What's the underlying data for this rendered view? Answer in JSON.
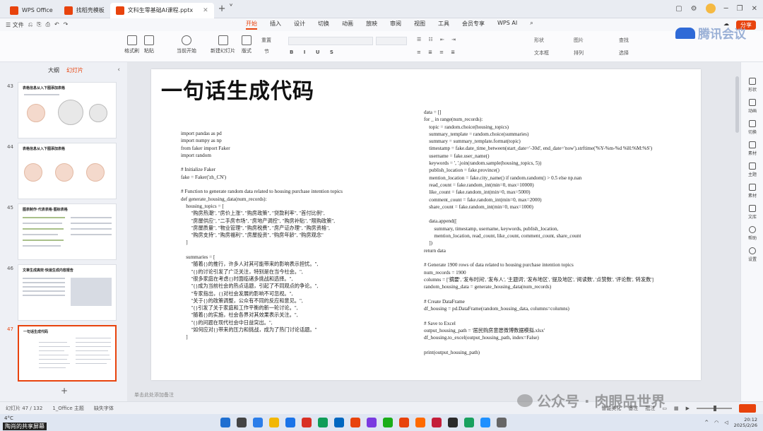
{
  "tabs": [
    {
      "label": "WPS Office",
      "color": "#e8430d"
    },
    {
      "label": "找稻壳模板",
      "color": "#e8430d"
    },
    {
      "label": "文科生零基础AI课程.pptx",
      "color": "#e8430d",
      "active": true
    }
  ],
  "menu": {
    "left_items": [
      "☰ 文件",
      "⎌",
      "⎘",
      "⎙",
      "↶",
      "↷"
    ],
    "tabs": [
      "开始",
      "插入",
      "设计",
      "切换",
      "动画",
      "放映",
      "审阅",
      "视图",
      "工具",
      "会员专享",
      "WPS AI"
    ],
    "active_tab": "开始",
    "share_label": "分享"
  },
  "ribbon": {
    "format_painter": "格式刷",
    "paste": "粘贴",
    "from_current": "当前开始",
    "new_slide": "新建幻灯片",
    "layout": "版式",
    "section": "节",
    "reset": "重置",
    "shape": "形状",
    "picture": "图片",
    "find": "查找",
    "arrange": "排列",
    "textbox": "文本框",
    "select": "选择"
  },
  "brand_watermark": "腾讯会议",
  "left_panel": {
    "tabs": [
      "大纲",
      "幻灯片"
    ],
    "active_tab": "幻灯片",
    "slides": [
      {
        "number": "43",
        "title": "表格信息从入下图添加表格"
      },
      {
        "number": "44",
        "title": "表格信息从入下图添加表格"
      },
      {
        "number": "45",
        "title": "图表制作·代表表格·图标表格"
      },
      {
        "number": "46",
        "title": "文章生成高效·快速生成内容报告"
      },
      {
        "number": "47",
        "title": "一句话生成代码",
        "selected": true
      }
    ],
    "add_label": "+"
  },
  "slide": {
    "title": "一句话生成代码",
    "code_left": "import pandas as pd\nimport numpy as np\nfrom faker import Faker\nimport random\n\n# Initialize Faker\nfake = Faker('zh_CN')\n\n# Function to generate random data related to housing purchase intention topics\ndef generate_housing_data(num_records):\n    housing_topics = [\n        \"购房热潮\", \"房价上涨\", \"购房政策\", \"贷款利率\", \"首付比例\",\n        \"房屋供应\", \"二手房市场\", \"房地产调控\", \"购房补贴\", \"限购政策\",\n        \"房屋质量\", \"物业管理\", \"购房税费\", \"房产证办理\", \"购房资格\",\n        \"购房支持\", \"购房福利\", \"房屋投资\", \"购房年龄\", \"购房观念\"\n    ]\n\n    summaries = [\n        \"随着{}的推行，许多人对其可能带来的影响表示担忧。\",\n        \"{}的讨论引发了广泛关注，特别是在当今社会。\",\n        \"很多家庭在考虑{}时面临诸多挑战和选择。\",\n        \"{}成为当前社会的热点话题，引起了不同观点的争论。\",\n        \"专家指出，{}对社会发展的影响不可忽视。\",\n        \"关于{}的政策调整，公众有不同的反应和意见。\",\n        \"{}引发了关于家庭和工作平衡的新一轮讨论。\",\n        \"随着{}的实施，社会各界对其效果表示关注。\",\n        \"{}的问题在现代社会中日益突出。\",\n        \"如何应对{}带来的压力和挑战，成为了热门讨论话题。\"\n    ]",
    "code_right": "data = []\nfor _ in range(num_records):\n    topic = random.choice(housing_topics)\n    summary_template = random.choice(summaries)\n    summary = summary_template.format(topic)\n    timestamp = fake.date_time_between(start_date='-30d', end_date='now').strftime('%Y-%m-%d %H:%M:%S')\n    username = fake.user_name()\n    keywords = ', '.join(random.sample(housing_topics, 5))\n    publish_location = fake.province()\n    mention_location = fake.city_name() if random.random() > 0.5 else np.nan\n    read_count = fake.random_int(min=0, max=10000)\n    like_count = fake.random_int(min=0, max=5000)\n    comment_count = fake.random_int(min=0, max=2000)\n    share_count = fake.random_int(min=0, max=1000)\n\n    data.append([\n        summary, timestamp, username, keywords, publish_location,\n        mention_location, read_count, like_count, comment_count, share_count\n    ])\nreturn data\n\n# Generate 1900 rows of data related to housing purchase intention topics\nnum_records = 1900\ncolumns = ['摘要', '发布时间', '发布人', '主题词', '发布地区', '提及地区', '阅读数', '点赞数', '评论数', '转发数']\nrandom_housing_data = generate_housing_data(num_records)\n\n# Create DataFrame\ndf_housing = pd.DataFrame(random_housing_data, columns=columns)\n\n# Save to Excel\noutput_housing_path = '居民购房意愿微博数据模拟.xlsx'\ndf_housing.to_excel(output_housing_path, index=False)\n\nprint(output_housing_path)"
  },
  "notes_placeholder": "单击此处添加备注",
  "right_sidebar": [
    "形状",
    "动画",
    "切换",
    "素材",
    "主题",
    "素材",
    "文库",
    "帮助",
    "设置"
  ],
  "statusbar": {
    "slide_counter": "幻灯片 47 / 132",
    "theme": "1_Office 主题",
    "font_missing": "缺失字体",
    "smart_beautify": "智能美化",
    "notes": "备注",
    "comments": "批注"
  },
  "wechat_watermark": "公众号 · 肉眼品世界",
  "taskbar": {
    "weather": "4°C",
    "caption": "陶肖的共享屏幕",
    "time": "20:12",
    "date": "2025/2/26",
    "icon_colors": [
      "#1f6fd1",
      "#444",
      "#2b7de9",
      "#f2b705",
      "#1a73e8",
      "#d93025",
      "#0f9d58",
      "#0067c0",
      "#e8430d",
      "#7a3ae0",
      "#1aad19",
      "#e8430d",
      "#ff6a00",
      "#c41e3a",
      "#2a2a2a",
      "#19a15f",
      "#1e90ff",
      "#666"
    ]
  }
}
